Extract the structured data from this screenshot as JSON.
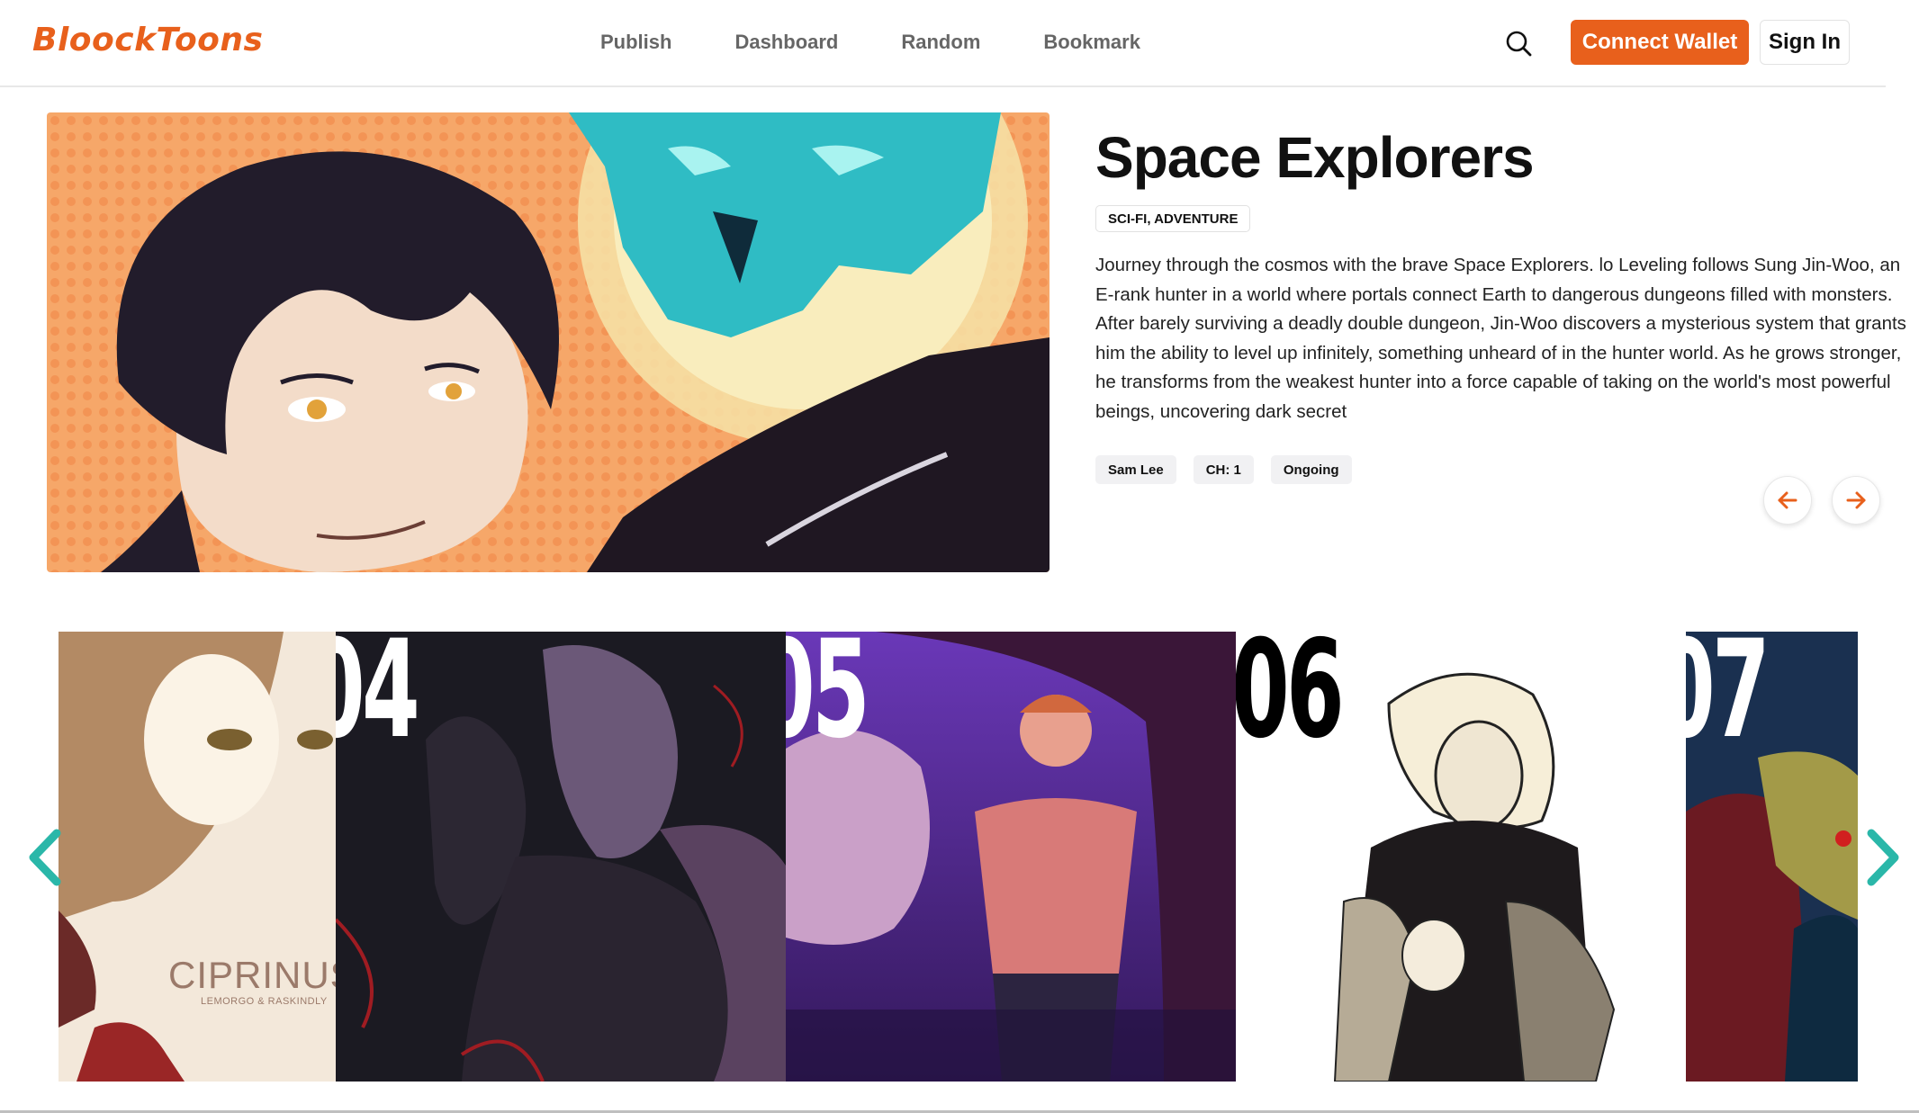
{
  "header": {
    "logo_text": "BloockToons",
    "nav": [
      "Publish",
      "Dashboard",
      "Random",
      "Bookmark"
    ],
    "connect_wallet": "Connect Wallet",
    "sign_in": "Sign In"
  },
  "hero": {
    "title": "Space Explorers",
    "genre": "SCI-FI, ADVENTURE",
    "description": "Journey through the cosmos with the brave Space Explorers. lo Leveling follows Sung Jin-Woo, an E-rank hunter in a world where portals connect Earth to dangerous dungeons filled with monsters. After barely surviving a deadly double dungeon, Jin-Woo discovers a mysterious system that grants him the ability to level up infinitely, something unheard of in the hunter world. As he grows stronger, he transforms from the weakest hunter into a force capable of taking on the world's most powerful beings, uncovering dark secret",
    "author": "Sam Lee",
    "chapter": "CH: 1",
    "status": "Ongoing"
  },
  "carousel": {
    "cards": [
      {
        "rank": "",
        "title": "CIPRINUS",
        "subtitle": "LEMORGO & RASKINDLY"
      },
      {
        "rank": "04",
        "title": "",
        "subtitle": ""
      },
      {
        "rank": "05",
        "title": "",
        "subtitle": ""
      },
      {
        "rank": "06",
        "title": "",
        "subtitle": ""
      },
      {
        "rank": "07",
        "title": "",
        "subtitle": ""
      }
    ]
  },
  "colors": {
    "accent": "#e8601c",
    "carousel_arrow": "#2ab7a9"
  },
  "icons": [
    "search-icon",
    "arrow-left-icon",
    "arrow-right-icon",
    "chevron-left-icon",
    "chevron-right-icon"
  ]
}
